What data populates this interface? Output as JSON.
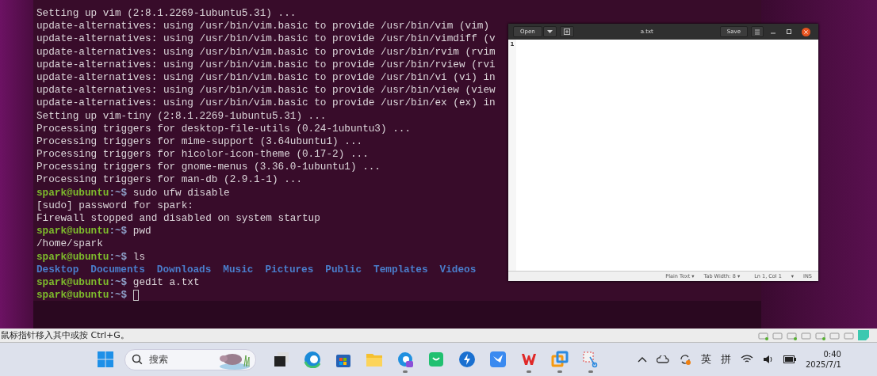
{
  "terminal": {
    "lines": [
      {
        "kind": "output",
        "text": "Setting up vim (2:8.1.2269-1ubuntu5.31) ..."
      },
      {
        "kind": "output",
        "text": "update-alternatives: using /usr/bin/vim.basic to provide /usr/bin/vim (vim)"
      },
      {
        "kind": "output",
        "text": "update-alternatives: using /usr/bin/vim.basic to provide /usr/bin/vimdiff (v"
      },
      {
        "kind": "output",
        "text": "update-alternatives: using /usr/bin/vim.basic to provide /usr/bin/rvim (rvim"
      },
      {
        "kind": "output",
        "text": "update-alternatives: using /usr/bin/vim.basic to provide /usr/bin/rview (rvi"
      },
      {
        "kind": "output",
        "text": "update-alternatives: using /usr/bin/vim.basic to provide /usr/bin/vi (vi) in"
      },
      {
        "kind": "output",
        "text": "update-alternatives: using /usr/bin/vim.basic to provide /usr/bin/view (view"
      },
      {
        "kind": "output",
        "text": "update-alternatives: using /usr/bin/vim.basic to provide /usr/bin/ex (ex) in"
      },
      {
        "kind": "output",
        "text": "Setting up vim-tiny (2:8.1.2269-1ubuntu5.31) ..."
      },
      {
        "kind": "output",
        "text": "Processing triggers for desktop-file-utils (0.24-1ubuntu3) ..."
      },
      {
        "kind": "output",
        "text": "Processing triggers for mime-support (3.64ubuntu1) ..."
      },
      {
        "kind": "output",
        "text": "Processing triggers for hicolor-icon-theme (0.17-2) ..."
      },
      {
        "kind": "output",
        "text": "Processing triggers for gnome-menus (3.36.0-1ubuntu1) ..."
      },
      {
        "kind": "output",
        "text": "Processing triggers for man-db (2.9.1-1) ..."
      },
      {
        "kind": "prompt",
        "user": "spark@ubuntu",
        "path": ":~$",
        "command": "sudo ufw disable"
      },
      {
        "kind": "output",
        "text": "[sudo] password for spark:"
      },
      {
        "kind": "output",
        "text": "Firewall stopped and disabled on system startup"
      },
      {
        "kind": "prompt",
        "user": "spark@ubuntu",
        "path": ":~$",
        "command": "pwd"
      },
      {
        "kind": "output",
        "text": "/home/spark"
      },
      {
        "kind": "prompt",
        "user": "spark@ubuntu",
        "path": ":~$",
        "command": "ls"
      },
      {
        "kind": "listing",
        "items": [
          "Desktop",
          "Documents",
          "Downloads",
          "Music",
          "Pictures",
          "Public",
          "Templates",
          "Videos"
        ]
      },
      {
        "kind": "prompt",
        "user": "spark@ubuntu",
        "path": ":~$",
        "command": "gedit a.txt"
      },
      {
        "kind": "prompt",
        "user": "spark@ubuntu",
        "path": ":~$",
        "cursor": true
      }
    ]
  },
  "editor": {
    "title": "a.txt",
    "open_button": "Open",
    "save_button": "Save",
    "line_number": "1",
    "status_bar": {
      "language": "Plain Text ▾",
      "tab_width": "Tab Width: 8 ▾",
      "position": "Ln 1, Col 1",
      "dropdown": "▾",
      "mode": "INS"
    }
  },
  "vm_status": {
    "hint": "鼠标指针移入其中或按 Ctrl+G。"
  },
  "taskbar": {
    "search_placeholder": "搜索",
    "apps": [
      {
        "kind": "task-view",
        "running": false
      },
      {
        "kind": "edge",
        "running": false
      },
      {
        "kind": "store",
        "running": false
      },
      {
        "kind": "folder",
        "running": false
      },
      {
        "kind": "edge-ai",
        "running": true
      },
      {
        "kind": "chat",
        "running": false
      },
      {
        "kind": "bolt",
        "running": false
      },
      {
        "kind": "bird",
        "running": false
      },
      {
        "kind": "wps",
        "running": true
      },
      {
        "kind": "vmware",
        "running": true
      },
      {
        "kind": "snip",
        "running": true
      }
    ],
    "ime_mode": "英",
    "ime_name": "拼",
    "time": "0:40",
    "date": "2025/7/1"
  }
}
